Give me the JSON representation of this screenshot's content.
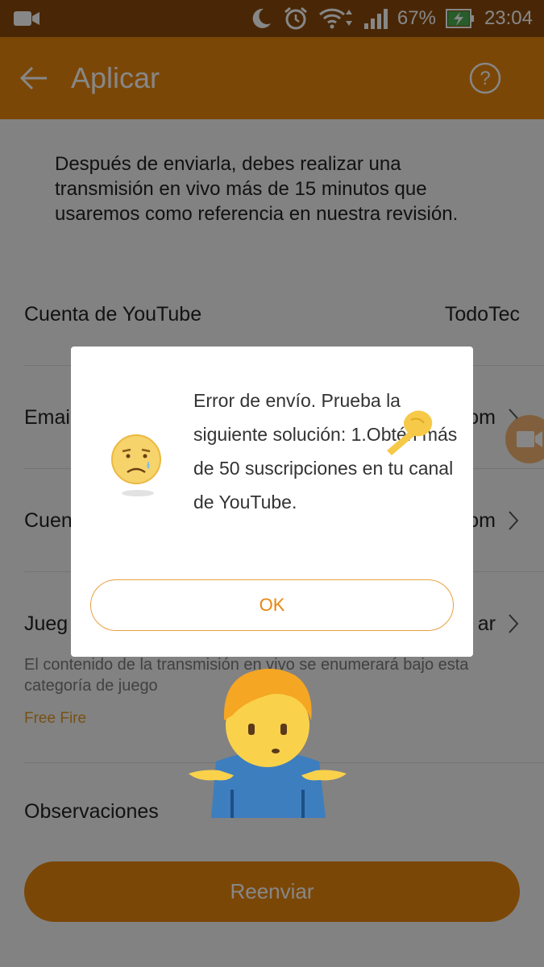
{
  "status_bar": {
    "battery": "67%",
    "time": "23:04"
  },
  "app_bar": {
    "title": "Aplicar"
  },
  "intro_text": "Después de enviarla, debes realizar una transmisión en vivo más de 15 minutos que usaremos como referencia en nuestra revisión.",
  "form": {
    "youtube_account": {
      "label": "Cuenta de YouTube",
      "value": "TodoTec"
    },
    "email": {
      "label_visible": "Emai",
      "value_visible": "om"
    },
    "account": {
      "label_visible": "Cuen",
      "value_visible": "om"
    },
    "game": {
      "label_visible": "Jueg",
      "value_visible": "ar",
      "description": "El contenido de la transmisión en vivo se enumerará bajo esta categoría de juego",
      "selected": "Free Fire"
    },
    "notes": {
      "label": "Observaciones"
    }
  },
  "resend_button": "Reenviar",
  "dialog": {
    "message": "Error de envío. Prueba la siguiente solución: 1.Obtén más de 50 suscripciones en tu canal de YouTube.",
    "ok_label": "OK"
  },
  "colors": {
    "accent": "#e8860f",
    "status_bar": "#8a4a0c",
    "game_value": "#e39a26"
  }
}
